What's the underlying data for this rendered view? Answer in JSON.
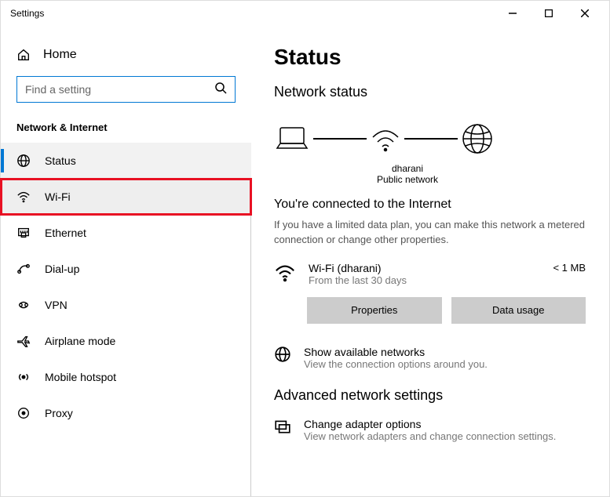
{
  "window": {
    "title": "Settings"
  },
  "sidebar": {
    "home": "Home",
    "search_placeholder": "Find a setting",
    "section": "Network & Internet",
    "items": [
      {
        "label": "Status"
      },
      {
        "label": "Wi-Fi"
      },
      {
        "label": "Ethernet"
      },
      {
        "label": "Dial-up"
      },
      {
        "label": "VPN"
      },
      {
        "label": "Airplane mode"
      },
      {
        "label": "Mobile hotspot"
      },
      {
        "label": "Proxy"
      }
    ]
  },
  "main": {
    "title": "Status",
    "subtitle": "Network status",
    "diagram": {
      "ssid": "dharani",
      "type": "Public network"
    },
    "connected_heading": "You're connected to the Internet",
    "connected_body": "If you have a limited data plan, you can make this network a metered connection or change other properties.",
    "connection": {
      "name": "Wi-Fi (dharani)",
      "period": "From the last 30 days",
      "usage": "< 1 MB"
    },
    "buttons": {
      "properties": "Properties",
      "data_usage": "Data usage"
    },
    "show_networks": {
      "title": "Show available networks",
      "sub": "View the connection options around you."
    },
    "advanced_heading": "Advanced network settings",
    "adapter": {
      "title": "Change adapter options",
      "sub": "View network adapters and change connection settings."
    }
  }
}
